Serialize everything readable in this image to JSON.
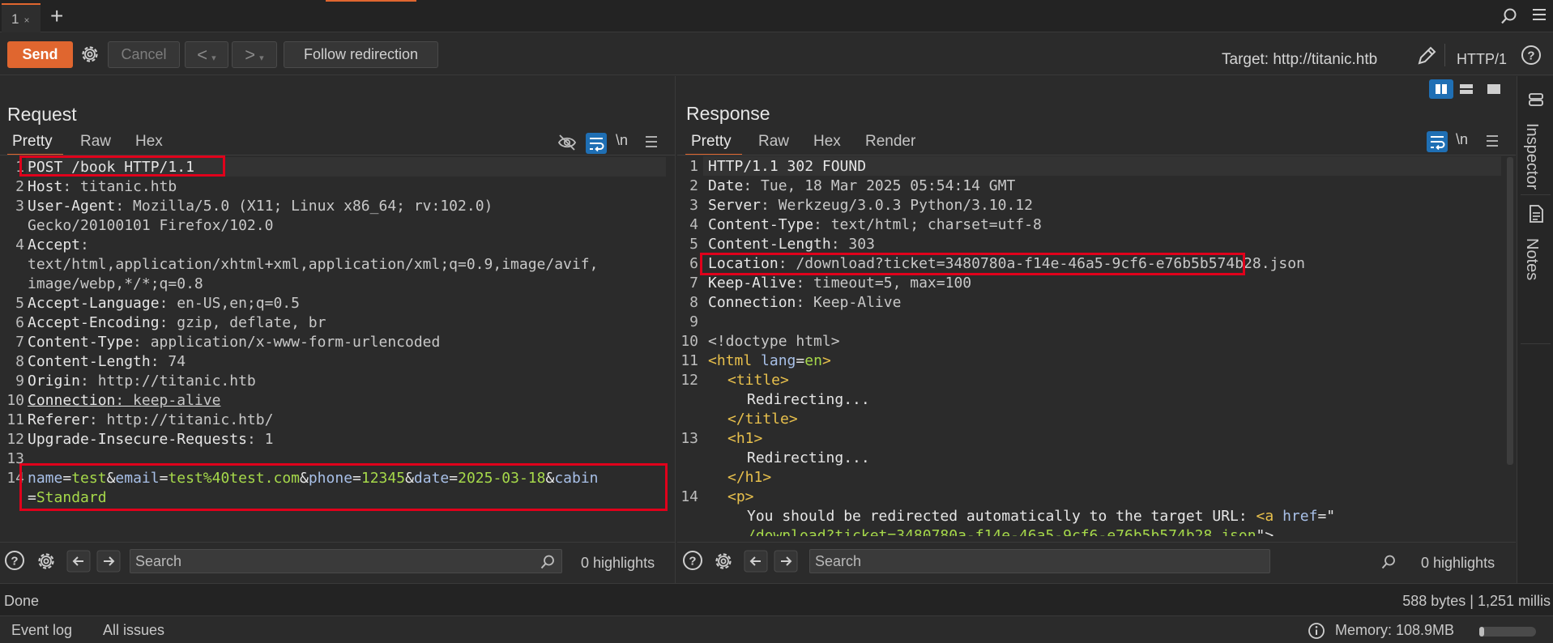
{
  "tabs": {
    "active_label": "1",
    "close_glyph": "×",
    "add_glyph": "+"
  },
  "toolbar": {
    "send_label": "Send",
    "cancel_label": "Cancel",
    "back_label": "<",
    "forward_label": ">",
    "dropdown_glyph": "▾",
    "follow_label": "Follow redirection",
    "target_label": "Target: http://titanic.htb",
    "http_version": "HTTP/1"
  },
  "request": {
    "title": "Request",
    "tabs": [
      "Pretty",
      "Raw",
      "Hex"
    ],
    "active_tab": "Pretty",
    "newline_toggle": "\\n",
    "search_placeholder": "Search",
    "highlights": "0 highlights",
    "line_numbers": [
      "1",
      "2",
      "3",
      "4",
      "5",
      "6",
      "7",
      "8",
      "9",
      "10",
      "11",
      "12",
      "13",
      "14"
    ],
    "lines": {
      "l1": "POST /book HTTP/1.1",
      "l2_k": "Host",
      "l2_v": ": titanic.htb",
      "l3_k": "User-Agent",
      "l3_v": ": Mozilla/5.0 (X11; Linux x86_64; rv:102.0)",
      "l3_wrap": "Gecko/20100101 Firefox/102.0",
      "l4_k": "Accept",
      "l4_v": ":",
      "l4_wrap1": "text/html,application/xhtml+xml,application/xml;q=0.9,image/avif,",
      "l4_wrap2": "image/webp,*/*;q=0.8",
      "l5_k": "Accept-Language",
      "l5_v": ": en-US,en;q=0.5",
      "l6_k": "Accept-Encoding",
      "l6_v": ": gzip, deflate, br",
      "l7_k": "Content-Type",
      "l7_v": ": application/x-www-form-urlencoded",
      "l8_k": "Content-Length",
      "l8_v": ": 74",
      "l9_k": "Origin",
      "l9_v": ": http://titanic.htb",
      "l10_k": "Connection",
      "l10_v": ": keep-alive",
      "l11_k": "Referer",
      "l11_v": ": http://titanic.htb/",
      "l12_k": "Upgrade-Insecure-Requests",
      "l12_v": ": 1",
      "body": {
        "n1": "name",
        "v1": "test",
        "n2": "email",
        "v2": "test%40test.com",
        "n3": "phone",
        "v3": "12345",
        "n4": "date",
        "v4": "2025-03-18",
        "n5": "cabin",
        "v5": "Standard"
      }
    }
  },
  "response": {
    "title": "Response",
    "tabs": [
      "Pretty",
      "Raw",
      "Hex",
      "Render"
    ],
    "active_tab": "Pretty",
    "newline_toggle": "\\n",
    "search_placeholder": "Search",
    "highlights": "0 highlights",
    "line_numbers": [
      "1",
      "2",
      "3",
      "4",
      "5",
      "6",
      "7",
      "8",
      "9",
      "10",
      "11",
      "12",
      "",
      "",
      "13",
      "",
      "",
      "14",
      ""
    ],
    "lines": {
      "l1": "HTTP/1.1 302 FOUND",
      "l2_k": "Date",
      "l2_v": ": Tue, 18 Mar 2025 05:54:14 GMT",
      "l3_k": "Server",
      "l3_v": ": Werkzeug/3.0.3 Python/3.10.12",
      "l4_k": "Content-Type",
      "l4_v": ": text/html; charset=utf-8",
      "l5_k": "Content-Length",
      "l5_v": ": 303",
      "l6_k": "Location",
      "l6_v": ": /download?ticket=3480780a-f14e-46a5-9cf6-e76b5b574b28.json",
      "l7_k": "Keep-Alive",
      "l7_v": ": timeout=5, max=100",
      "l8_k": "Connection",
      "l8_v": ": Keep-Alive",
      "l10": "<!doctype html>",
      "l11_open": "<",
      "l11_tag": "html",
      "l11_attr": "lang",
      "l11_eq": "=",
      "l11_val": "en",
      "l11_close": ">",
      "l12_title_open": "<title>",
      "l12_text": "Redirecting...",
      "l12_title_close": "</title>",
      "l13_h1_open": "<h1>",
      "l13_text": "Redirecting...",
      "l13_h1_close": "</h1>",
      "l14_p_open": "<p>",
      "l14_text": "You should be redirected automatically to the target URL: ",
      "l14_a_open": "<a",
      "l14_href": "href",
      "l14_eq": "=\"",
      "l14_href_val": "/download?ticket=3480780a-f14e-46a5-9cf6-e76b5b574b28.json",
      "l14_close": "\">."
    }
  },
  "side": {
    "inspector_label": "Inspector",
    "notes_label": "Notes"
  },
  "status": {
    "text": "Done",
    "bytes": "588 bytes | 1,251 millis"
  },
  "bottom": {
    "event_log": "Event log",
    "all_issues": "All issues",
    "memory": "Memory: 108.9MB"
  },
  "memory_usage_fraction": 0.08,
  "colors": {
    "accent": "#e0662f",
    "highlight_box": "#e0001b",
    "toggle_active": "#1f6fb4"
  }
}
